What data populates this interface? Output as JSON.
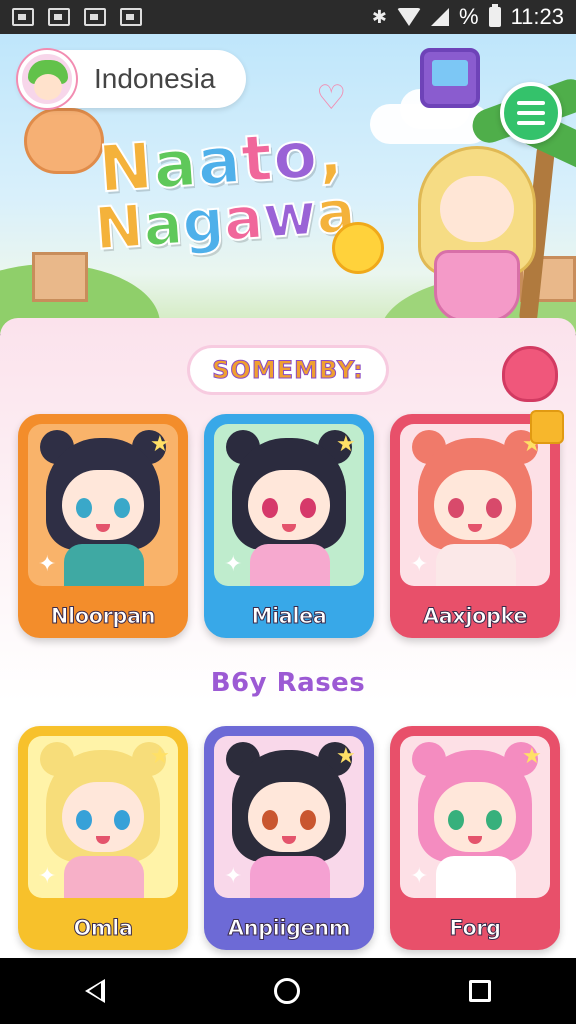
{
  "status_bar": {
    "time": "11:23",
    "battery_label": "%",
    "icons": [
      "gallery-icon",
      "voicemail-icon",
      "message-icon",
      "keyboard-icon",
      "bluetooth-icon",
      "wifi-icon",
      "signal-icon",
      "battery-icon"
    ]
  },
  "header": {
    "region": "Indonesia",
    "logo_line1": "Naato,",
    "logo_line2": "Nagawa",
    "logo_colors": [
      "#f4b23b",
      "#5fc85a",
      "#4fb0ea",
      "#f0679b",
      "#9a63d6"
    ]
  },
  "sections": [
    {
      "title": "SOMEMBY:",
      "cards": [
        {
          "name": "Nloorpan",
          "frame": "#f38d2b",
          "bg": "#f9b36a",
          "hair": "#2f2f45",
          "eye": "#3aa8c9",
          "body": "#3fa9a3"
        },
        {
          "name": "Mialea",
          "frame": "#38a8e8",
          "bg": "#bfeccd",
          "hair": "#2b2b3e",
          "eye": "#d6396a",
          "body": "#f6a9cf"
        },
        {
          "name": "Aaxjopke",
          "frame": "#e8506a",
          "bg": "#fde0e6",
          "hair": "#f07a6a",
          "eye": "#d84a6b",
          "body": "#fbe8e8"
        }
      ]
    },
    {
      "title": "B6y Rases",
      "cards": [
        {
          "name": "Omla",
          "frame": "#f7c12b",
          "bg": "#fff3a8",
          "hair": "#f7dd7a",
          "eye": "#36a1d8",
          "body": "#f7b0c8"
        },
        {
          "name": "Anpiigenm",
          "frame": "#6d6ad6",
          "bg": "#f9d8ea",
          "hair": "#2c2c3b",
          "eye": "#c9562f",
          "body": "#f5a1d2"
        },
        {
          "name": "Forg",
          "frame": "#e8506a",
          "bg": "#fde0e6",
          "hair": "#f48cc0",
          "eye": "#37b07c",
          "body": "#ffffff"
        }
      ]
    }
  ],
  "nav": {
    "icons": [
      "back-icon",
      "home-icon",
      "recent-apps-icon"
    ]
  }
}
